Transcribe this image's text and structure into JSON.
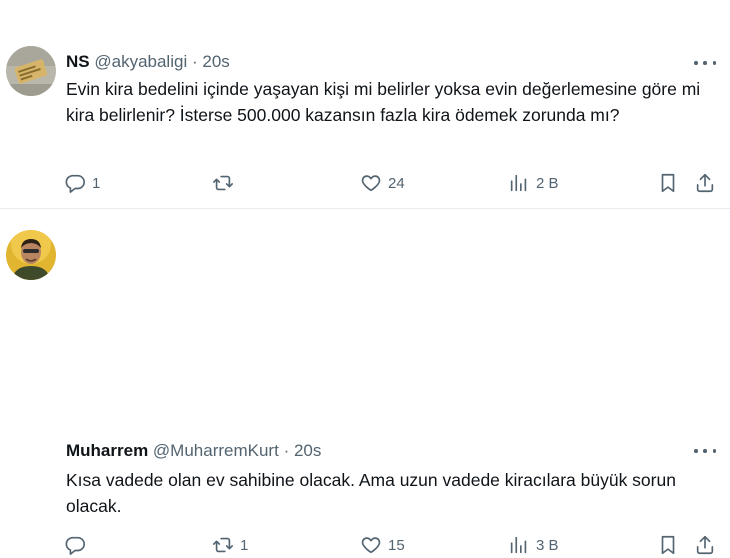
{
  "tweets": [
    {
      "name": "NS",
      "handle": "@akyabaligi",
      "separator": "·",
      "time": "20s",
      "text": "Evin kira bedelini içinde yaşayan kişi mi belirler yoksa evin değerlemesine göre mi kira belirlenir? İsterse 500.000 kazansın fazla kira ödemek zorunda mı?",
      "replies": "1",
      "reposts": "",
      "likes": "24",
      "views": "2 B"
    },
    {
      "name": "Muharrem",
      "handle": "@MuharremKurt",
      "separator": "·",
      "time": "20s",
      "text": "Kısa vadede olan ev sahibine olacak. Ama uzun vadede kiracılara büyük sorun  olacak.",
      "replies": "",
      "reposts": "1",
      "likes": "15",
      "views": "3 B"
    }
  ],
  "icons": {
    "reply": "reply-icon",
    "repost": "repost-icon",
    "like": "heart-icon",
    "views": "views-icon",
    "bookmark": "bookmark-icon",
    "share": "share-icon",
    "more": "more-icon"
  }
}
